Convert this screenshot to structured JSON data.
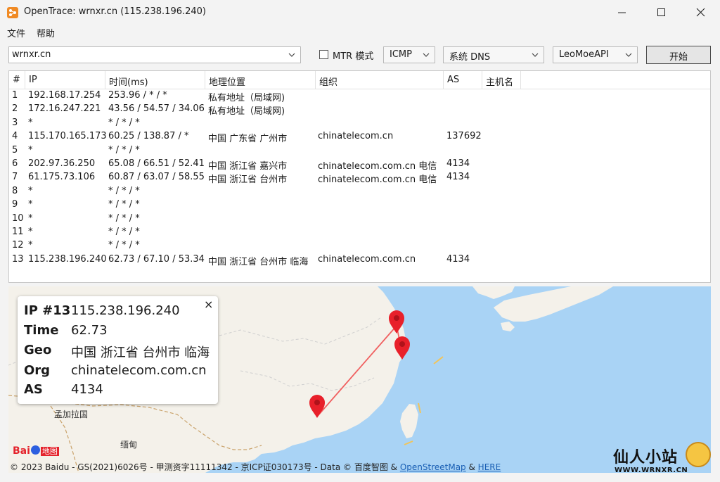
{
  "window": {
    "title": "OpenTrace: wrnxr.cn (115.238.196.240)"
  },
  "menu": {
    "file": "文件",
    "help": "帮助"
  },
  "toolbar": {
    "host_value": "wrnxr.cn",
    "mtr_label": "MTR 模式",
    "mtr_checked": false,
    "protocol": "ICMP",
    "dns": "系统 DNS",
    "geo_api": "LeoMoeAPI",
    "start_label": "开始"
  },
  "table": {
    "columns": [
      "#",
      "IP",
      "时间(ms)",
      "地理位置",
      "组织",
      "AS",
      "主机名"
    ],
    "rows": [
      {
        "n": "1",
        "ip": "192.168.17.254",
        "time": "253.96 / * / *",
        "geo": "私有地址（局域网)",
        "org": "",
        "as": "",
        "host": ""
      },
      {
        "n": "2",
        "ip": "172.16.247.221",
        "time": "43.56 / 54.57 / 34.06",
        "geo": "私有地址（局域网)",
        "org": "",
        "as": "",
        "host": ""
      },
      {
        "n": "3",
        "ip": "*",
        "time": "* / * / *",
        "geo": "",
        "org": "",
        "as": "",
        "host": ""
      },
      {
        "n": "4",
        "ip": "115.170.165.173",
        "time": "60.25 / 138.87 / *",
        "geo": "中国 广东省 广州市",
        "org": "chinatelecom.cn",
        "as": "137692",
        "host": ""
      },
      {
        "n": "5",
        "ip": "*",
        "time": "* / * / *",
        "geo": "",
        "org": "",
        "as": "",
        "host": ""
      },
      {
        "n": "6",
        "ip": "202.97.36.250",
        "time": "65.08 / 66.51 / 52.41",
        "geo": "中国 浙江省 嘉兴市",
        "org": "chinatelecom.com.cn  电信",
        "as": "4134",
        "host": ""
      },
      {
        "n": "7",
        "ip": "61.175.73.106",
        "time": "60.87 / 63.07 / 58.55",
        "geo": "中国 浙江省 台州市",
        "org": "chinatelecom.com.cn  电信",
        "as": "4134",
        "host": ""
      },
      {
        "n": "8",
        "ip": "*",
        "time": "* / * / *",
        "geo": "",
        "org": "",
        "as": "",
        "host": ""
      },
      {
        "n": "9",
        "ip": "*",
        "time": "* / * / *",
        "geo": "",
        "org": "",
        "as": "",
        "host": ""
      },
      {
        "n": "10",
        "ip": "*",
        "time": "* / * / *",
        "geo": "",
        "org": "",
        "as": "",
        "host": ""
      },
      {
        "n": "11",
        "ip": "*",
        "time": "* / * / *",
        "geo": "",
        "org": "",
        "as": "",
        "host": ""
      },
      {
        "n": "12",
        "ip": "*",
        "time": "* / * / *",
        "geo": "",
        "org": "",
        "as": "",
        "host": ""
      },
      {
        "n": "13",
        "ip": "115.238.196.240",
        "time": "62.73 / 67.10 / 53.34",
        "geo": "中国 浙江省 台州市 临海",
        "org": "chinatelecom.com.cn",
        "as": "4134",
        "host": ""
      }
    ]
  },
  "popup": {
    "ip_label": "IP #13",
    "ip": "115.238.196.240",
    "time_label": "Time",
    "time": "62.73",
    "geo_label": "Geo",
    "geo": "中国 浙江省 台州市 临海",
    "org_label": "Org",
    "org": "chinatelecom.com.cn",
    "as_label": "AS",
    "as": "4134",
    "close": "×"
  },
  "map": {
    "labels": {
      "bangladesh": "孟加拉国",
      "myanmar": "缅甸"
    },
    "logo_text": "Bai",
    "logo_suffix": "地图",
    "attribution_prefix": "© 2023 Baidu - GS(2021)6026号 - 甲测资字11111342 - 京ICP证030173号 - Data © 百度智图 & ",
    "osm_link": "OpenStreetMap",
    "amp": " & ",
    "here_link": "HERE",
    "land_color": "#f4f1ea",
    "sea_color": "#a9d3f5",
    "route_color": "#f06060",
    "marker_color": "#e8202a"
  },
  "watermark": {
    "text": "仙人小站",
    "url": "WWW.WRNXR.CN"
  },
  "colors": {
    "app_icon": "#f08a24",
    "link": "#1a5fb4"
  }
}
